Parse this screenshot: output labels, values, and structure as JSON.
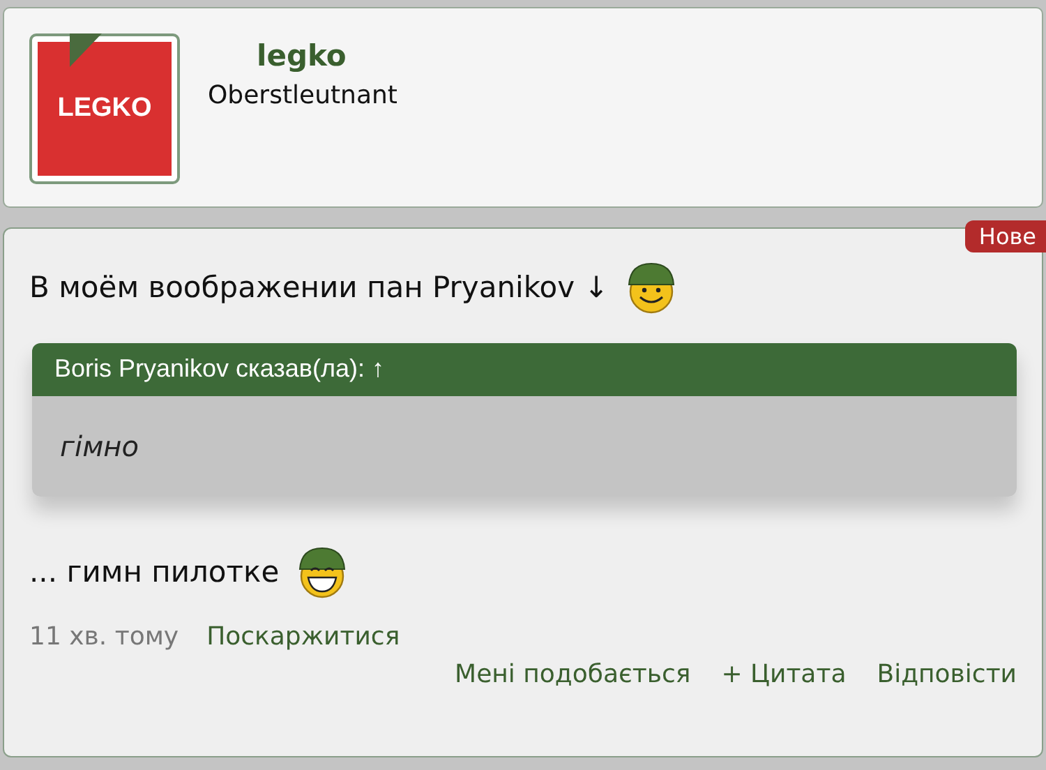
{
  "profile": {
    "avatar_text": "LEGKO",
    "username": "legko",
    "rank": "Oberstleutnant"
  },
  "post": {
    "badge": "Нове",
    "intro": "В моём воображении пан Pryanikov ↓",
    "quote": {
      "header": "Boris Pryanikov сказав(ла): ↑",
      "text": "гімно"
    },
    "outro": "... гимн пилотке",
    "time": "11 хв. тому",
    "report": "Поскаржитися",
    "actions": [
      "Мені подобається",
      "+ Цитата",
      "Відповісти"
    ]
  }
}
